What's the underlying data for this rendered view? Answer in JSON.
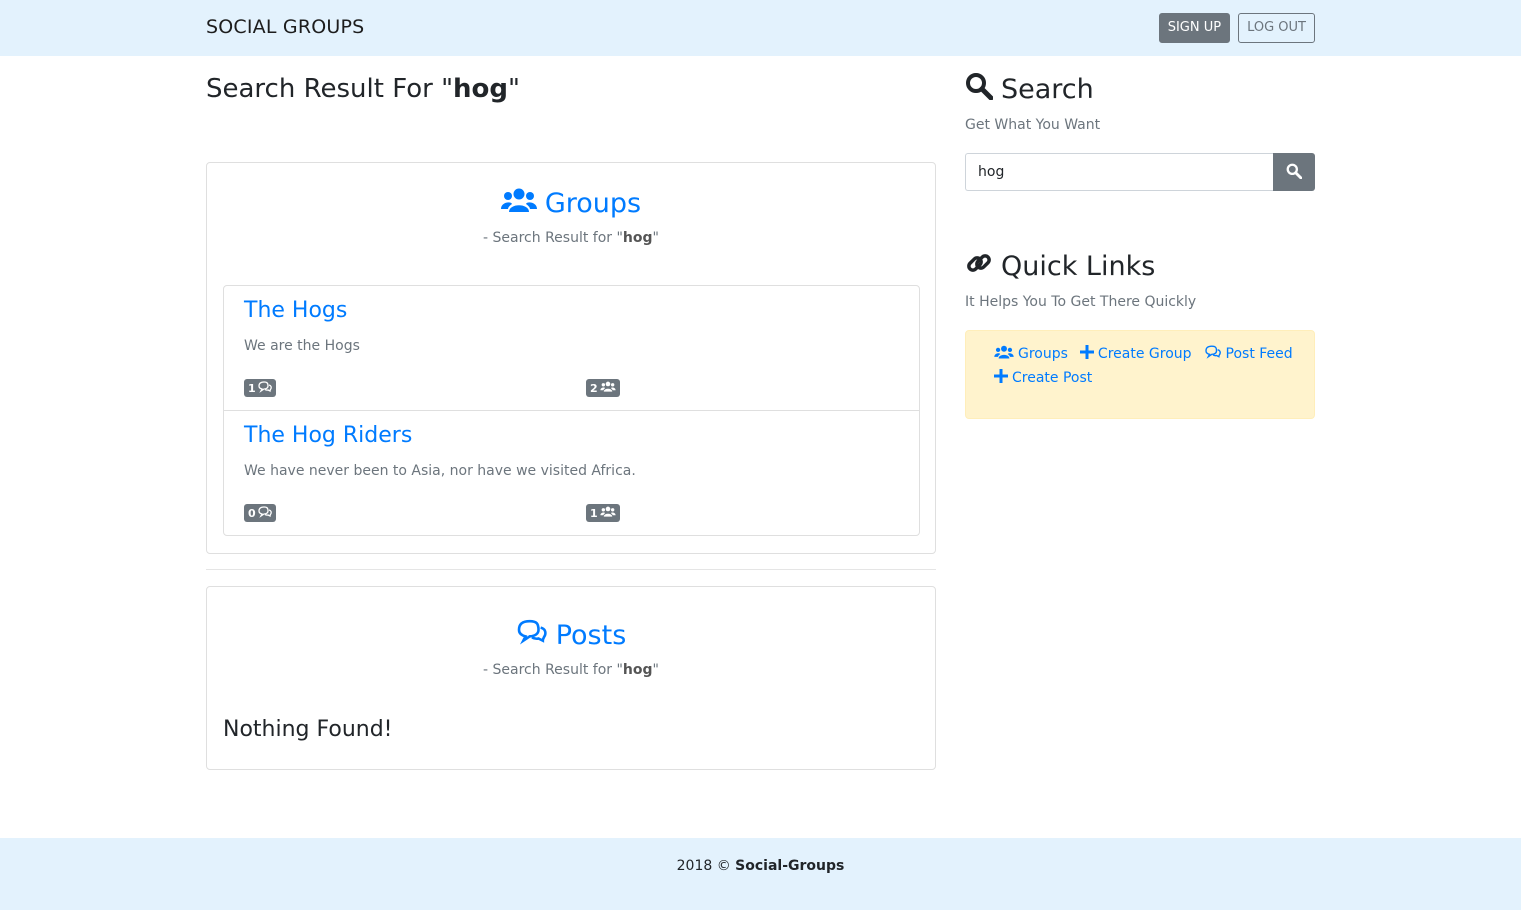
{
  "navbar": {
    "brand": "SOCIAL GROUPS",
    "signup_label": "SIGN UP",
    "logout_label": "LOG OUT"
  },
  "main": {
    "title_prefix": "Search Result For \"",
    "query": "hog",
    "title_suffix": "\""
  },
  "groups_section": {
    "heading": "Groups",
    "sub_prefix": "- Search Result for \"",
    "sub_query": "hog",
    "sub_suffix": "\"",
    "items": [
      {
        "title": "The Hogs",
        "description": "We are the Hogs",
        "posts_count": "1",
        "members_count": "2"
      },
      {
        "title": "The Hog Riders",
        "description": "We have never been to Asia, nor have we visited Africa.",
        "posts_count": "0",
        "members_count": "1"
      }
    ]
  },
  "posts_section": {
    "heading": "Posts",
    "sub_prefix": "- Search Result for \"",
    "sub_query": "hog",
    "sub_suffix": "\"",
    "empty_text": "Nothing Found!"
  },
  "sidebar": {
    "search_heading": "Search",
    "search_sub": "Get What You Want",
    "search_value": "hog",
    "quick_heading": "Quick Links",
    "quick_sub": "It Helps You To Get There Quickly",
    "quick_links": [
      "Groups",
      "Create Group",
      "Post Feed",
      "Create Post"
    ]
  },
  "footer": {
    "prefix": "2018 © ",
    "brand": "Social-Groups"
  },
  "colors": {
    "navbar_bg": "#e3f2fd",
    "link": "#007bff",
    "secondary": "#6c757d",
    "quick_box_bg": "#fff3cd"
  },
  "icons": [
    "users-icon",
    "comments-icon",
    "search-icon",
    "link-icon",
    "plus-icon"
  ]
}
